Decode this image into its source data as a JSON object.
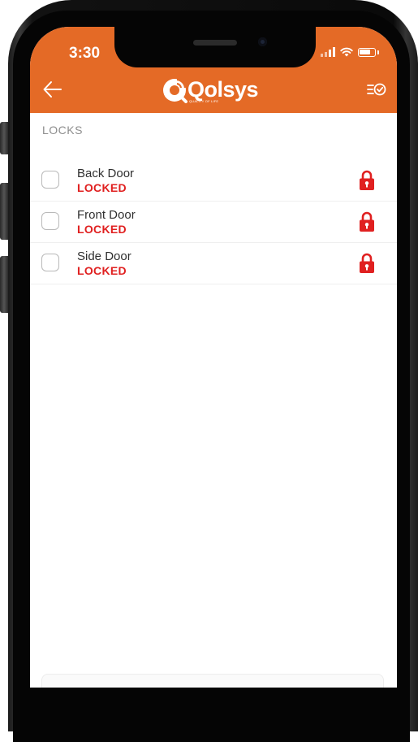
{
  "status_bar": {
    "time": "3:30"
  },
  "header": {
    "brand_name": "Qolsys",
    "brand_tagline": "QUALITY OF LIFE",
    "back_icon": "arrow-left-icon",
    "select_icon": "checklist-icon"
  },
  "colors": {
    "header": "#e46a26",
    "locked": "#e02020"
  },
  "section": {
    "title": "LOCKS"
  },
  "locks": [
    {
      "name": "Back Door",
      "status": "LOCKED",
      "checked": false,
      "icon": "padlock-icon"
    },
    {
      "name": "Front Door",
      "status": "LOCKED",
      "checked": false,
      "icon": "padlock-icon"
    },
    {
      "name": "Side Door",
      "status": "LOCKED",
      "checked": false,
      "icon": "padlock-icon"
    }
  ]
}
